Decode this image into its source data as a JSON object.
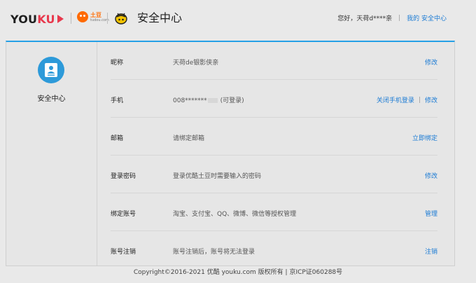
{
  "header": {
    "logo_text_1": "YOU",
    "logo_text_2": "KU",
    "tudou_name": "土豆",
    "tudou_sub": "tudou.com",
    "page_title": "安全中心",
    "greeting": "您好，",
    "username": "天荷d****亲",
    "divider": "|",
    "my_security_link": "我的 安全中心"
  },
  "sidebar": {
    "label": "安全中心",
    "icon": "id-card-icon"
  },
  "rows": [
    {
      "label": "昵称",
      "value": "天荷de银影侠亲",
      "actions": [
        "修改"
      ]
    },
    {
      "label": "手机",
      "value_prefix": "008*******",
      "value_suffix": "(可登录)",
      "actions": [
        "关闭手机登录",
        "修改"
      ]
    },
    {
      "label": "邮箱",
      "value": "请绑定邮箱",
      "actions": [
        "立即绑定"
      ]
    },
    {
      "label": "登录密码",
      "value": "登录优酷土豆时需要输入的密码",
      "actions": [
        "修改"
      ]
    },
    {
      "label": "绑定账号",
      "value": "淘宝、支付宝、QQ、微博、微信等授权管理",
      "actions": [
        "管理"
      ]
    },
    {
      "label": "账号注销",
      "value": "账号注销后，账号将无法登录",
      "actions": [
        "注销"
      ]
    }
  ],
  "footer": {
    "copyright": "Copyright©2016-2021 优酷 youku.com 版权所有 | 京ICP证060288号"
  },
  "colors": {
    "accent": "#26a0e6",
    "link": "#1b7bd4",
    "brand_red": "#e8394d",
    "tudou_orange": "#ff6a00"
  }
}
